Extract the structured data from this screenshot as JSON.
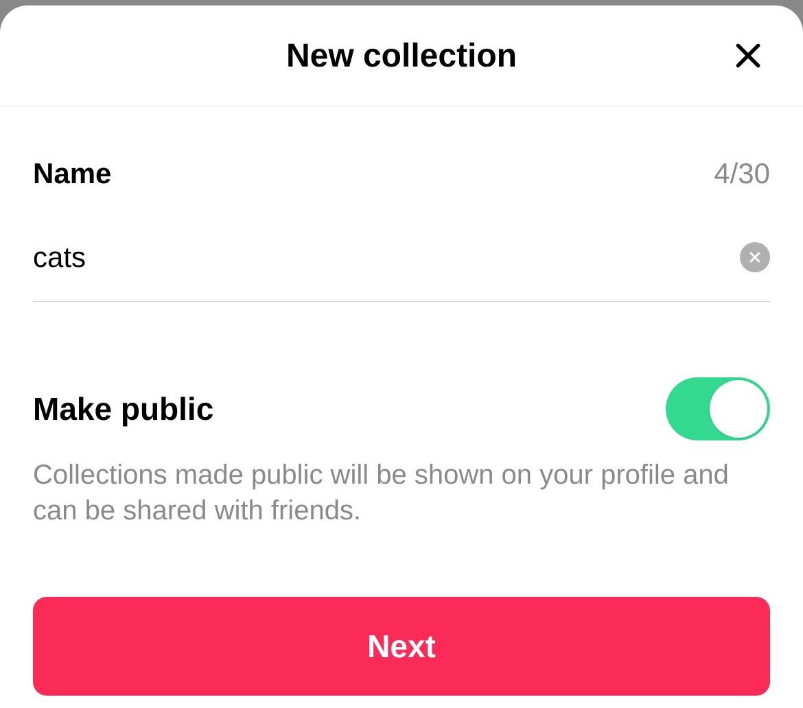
{
  "header": {
    "title": "New collection"
  },
  "name_section": {
    "label": "Name",
    "char_count": "4/30",
    "value": "cats"
  },
  "public_section": {
    "label": "Make public",
    "description": "Collections made public will be shown on your profile and can be shared with friends.",
    "toggle_on": true
  },
  "actions": {
    "next_label": "Next"
  }
}
